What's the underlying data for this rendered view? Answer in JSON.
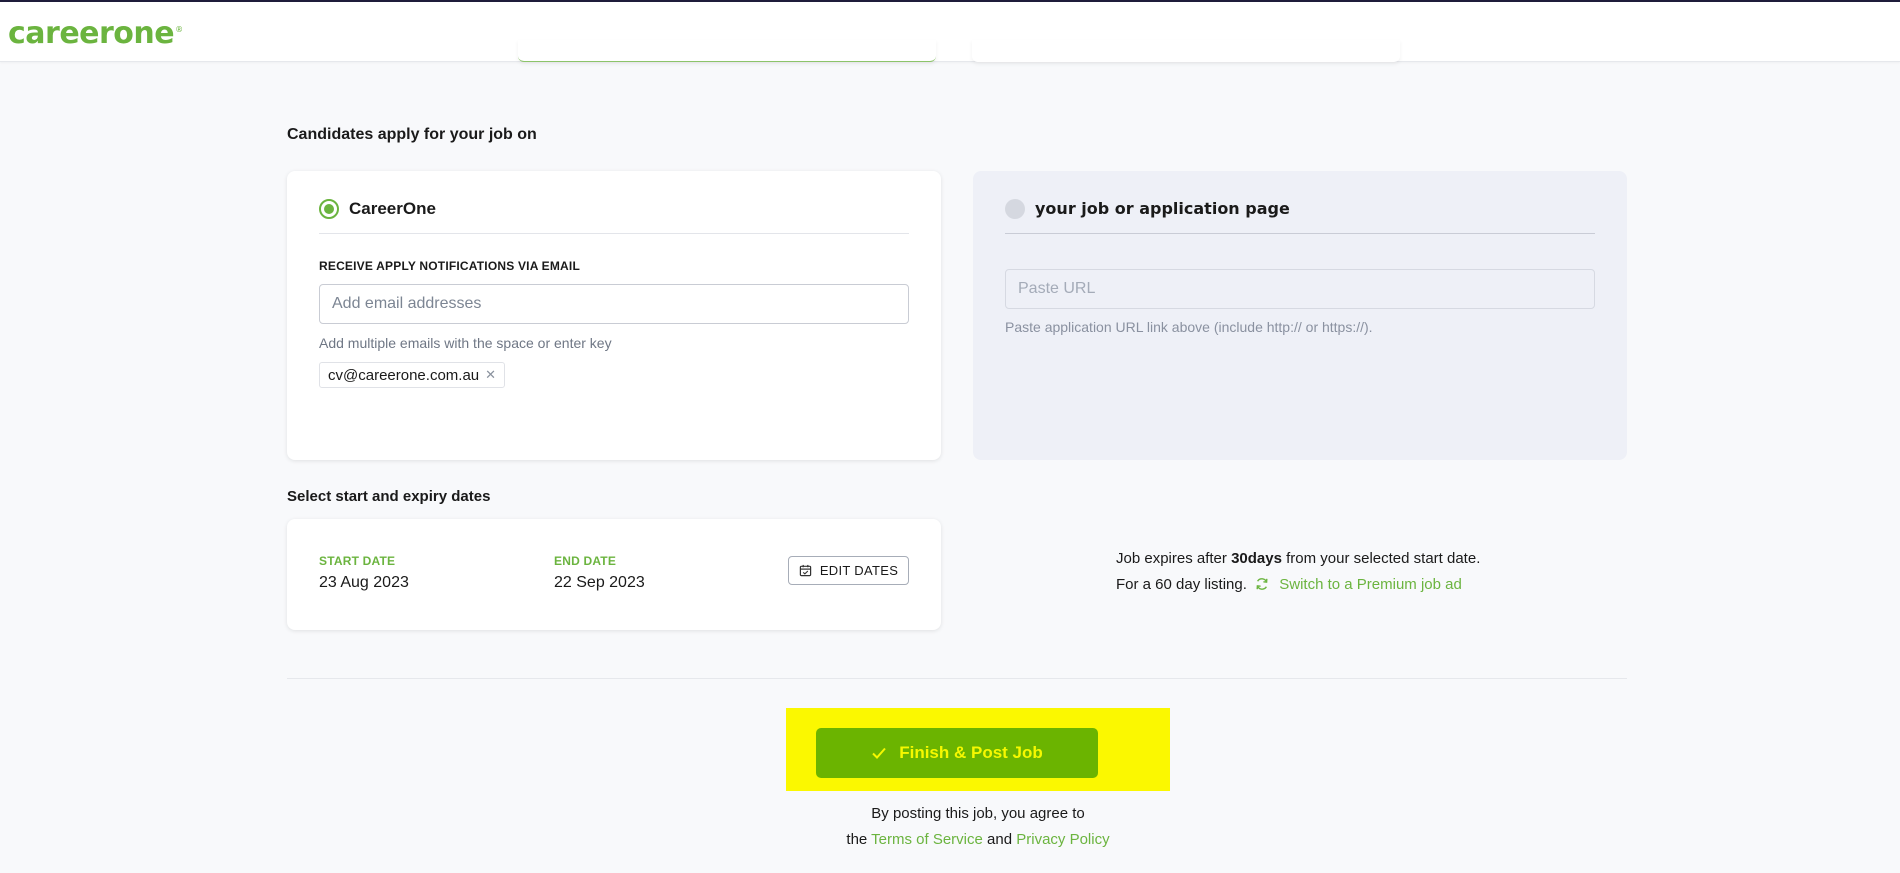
{
  "header": {
    "logo_text": "careerone",
    "logo_mark": "®"
  },
  "apply": {
    "section_title": "Candidates apply for your job on",
    "careerone_option": {
      "label": "CareerOne",
      "selected": true,
      "email_field_label": "RECEIVE APPLY NOTIFICATIONS VIA EMAIL",
      "email_placeholder": "Add email addresses",
      "email_hint": "Add multiple emails with the space or enter key",
      "emails": [
        "cv@careerone.com.au"
      ],
      "remove_symbol": "✕"
    },
    "url_option": {
      "label": "your job or application page",
      "selected": false,
      "url_placeholder": "Paste URL",
      "url_hint": "Paste application URL link above (include http:// or https://)."
    }
  },
  "dates": {
    "section_title": "Select start and expiry dates",
    "start_label": "START DATE",
    "start_value": "23 Aug 2023",
    "end_label": "END DATE",
    "end_value": "22 Sep 2023",
    "edit_button": "EDIT DATES",
    "expiry_prefix": "Job expires after ",
    "expiry_days": "30days",
    "expiry_suffix": " from your selected start date.",
    "listing_text": "For a 60 day listing.",
    "premium_link": "Switch to a Premium job ad"
  },
  "footer": {
    "post_button": "Finish & Post Job",
    "agree_line1": "By posting this job, you agree to",
    "agree_prefix": "the ",
    "terms_link": "Terms of Service",
    "agree_and": " and ",
    "privacy_link": "Privacy Policy"
  },
  "colors": {
    "brand_green": "#6bb43f",
    "button_green": "#6bb400",
    "highlight_yellow": "#fbf800",
    "button_text": "#f6f800"
  },
  "icons": {
    "radio_selected": "radio-selected-icon",
    "radio_unselected": "radio-unselected-icon",
    "chip_remove": "close-icon",
    "edit_dates": "calendar-icon",
    "premium": "refresh-icon",
    "post": "check-icon"
  }
}
